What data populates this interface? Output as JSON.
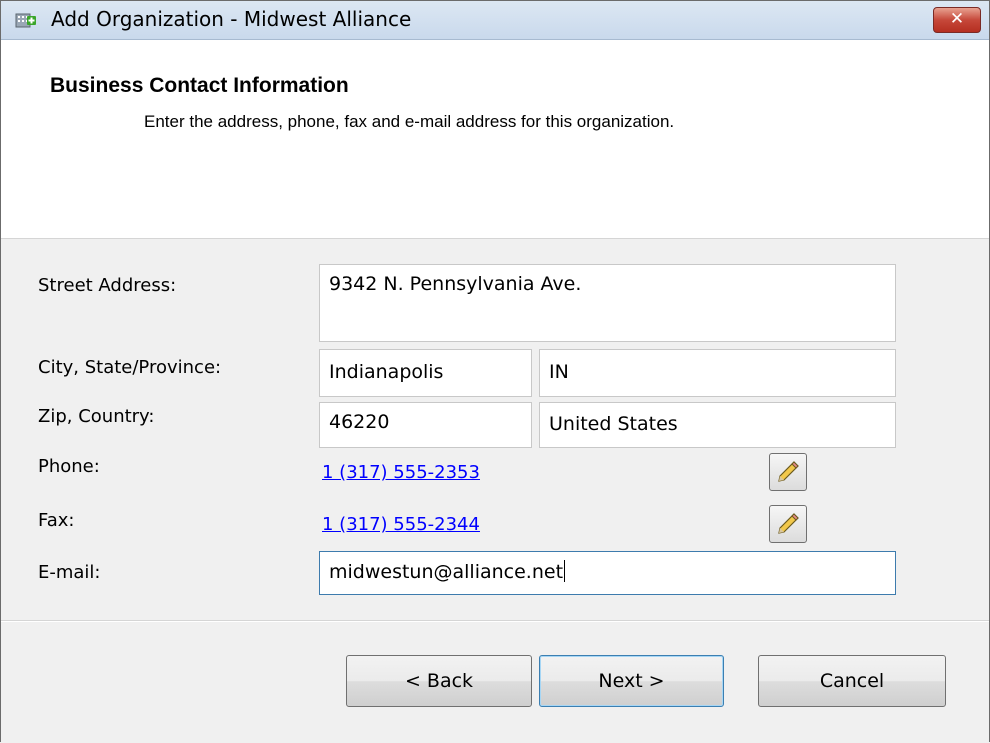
{
  "window": {
    "title": "Add Organization - Midwest Alliance",
    "close_glyph": "✕"
  },
  "header": {
    "title": "Business Contact Information",
    "subtitle": "Enter the address, phone, fax and e-mail address for this organization."
  },
  "form": {
    "street_label": "Street Address:",
    "street_value": "9342 N. Pennsylvania Ave.",
    "city_state_label": "City, State/Province:",
    "city_value": "Indianapolis",
    "state_value": "IN",
    "zip_country_label": "Zip, Country:",
    "zip_value": "46220",
    "country_value": "United States",
    "phone_label": "Phone:",
    "phone_value": "1 (317) 555-2353",
    "fax_label": "Fax:",
    "fax_value": "1 (317) 555-2344",
    "email_label": "E-mail:",
    "email_value": "midwestun@alliance.net"
  },
  "buttons": {
    "back": "< Back",
    "next": "Next >",
    "cancel": "Cancel"
  },
  "icons": {
    "app": "organization-icon",
    "edit": "pencil-icon"
  }
}
